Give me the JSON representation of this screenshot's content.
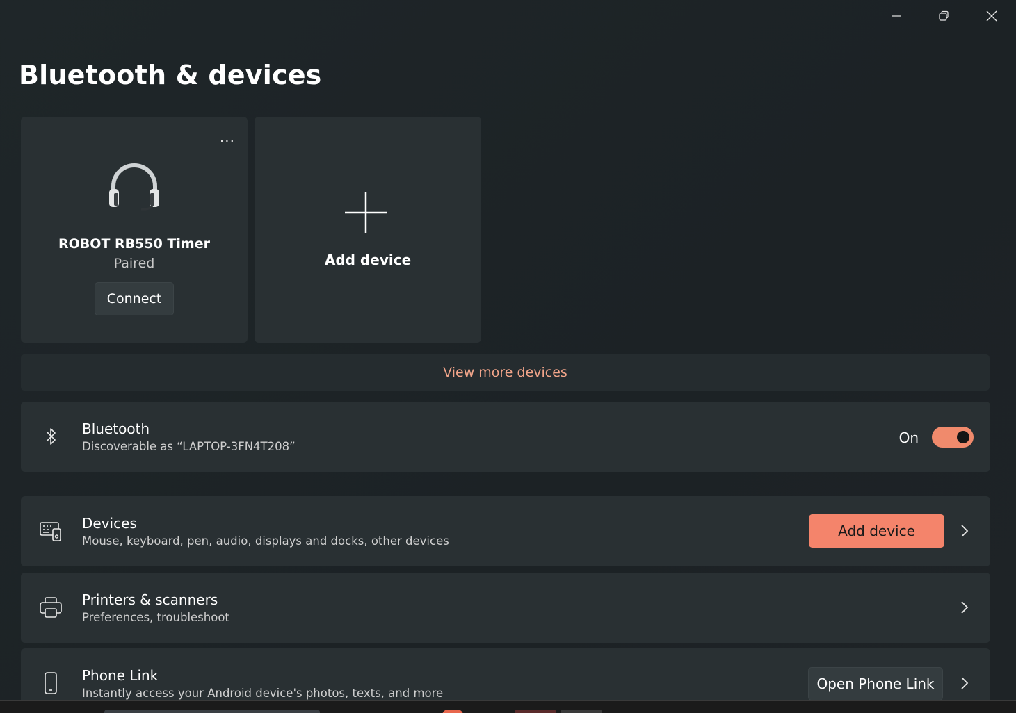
{
  "window": {
    "title": "Bluetooth & devices",
    "controls": [
      "minimize-icon",
      "restore-icon",
      "close-icon"
    ]
  },
  "paired_device": {
    "icon": "headset-icon",
    "name": "ROBOT RB550 Timer",
    "status": "Paired",
    "connect_label": "Connect",
    "more_label": "..."
  },
  "add_device_card": {
    "icon": "plus-icon",
    "label": "Add device"
  },
  "view_more": "View more devices",
  "bluetooth": {
    "icon": "bluetooth-icon",
    "title": "Bluetooth",
    "subtitle": "Discoverable as “LAPTOP-3FN4T208”",
    "state_label": "On",
    "enabled": true
  },
  "settings_rows": [
    {
      "icon": "devices-icon",
      "title": "Devices",
      "subtitle": "Mouse, keyboard, pen, audio, displays and docks, other devices",
      "button_label": "Add device"
    },
    {
      "icon": "printer-icon",
      "title": "Printers & scanners",
      "subtitle": "Preferences, troubleshoot"
    },
    {
      "icon": "phone-icon",
      "title": "Phone Link",
      "subtitle": "Instantly access your Android device's photos, texts, and more",
      "button_label": "Open Phone Link"
    }
  ],
  "colors": {
    "background": "#1e2427",
    "card": "#293033",
    "accent": "#f4846b",
    "accent_text": "#f2a58a"
  }
}
